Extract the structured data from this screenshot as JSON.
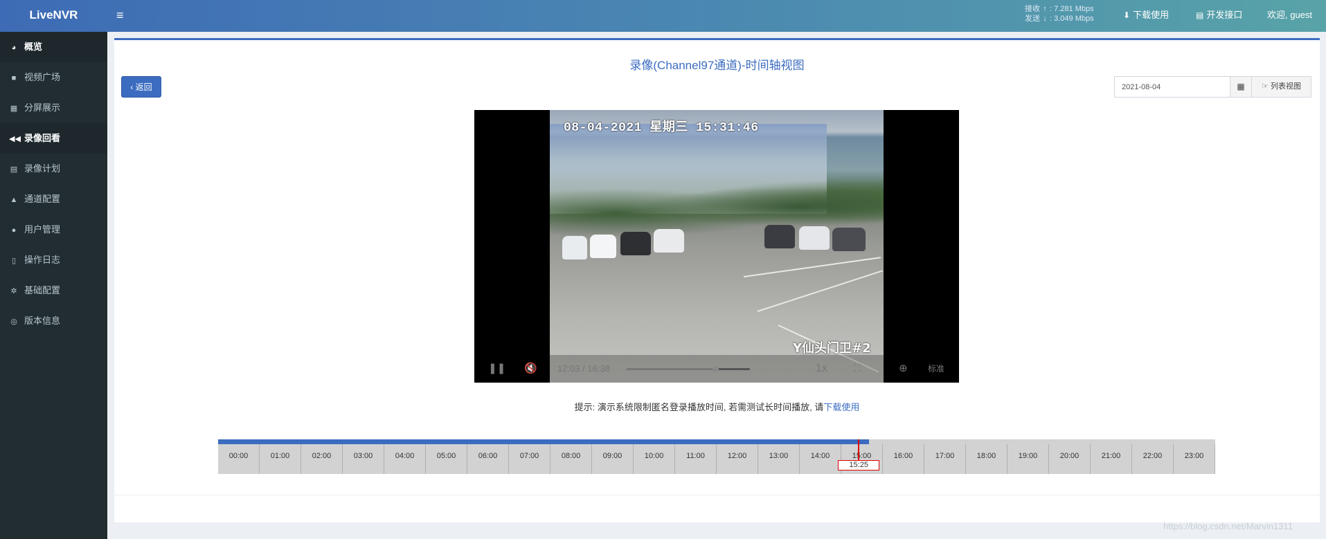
{
  "header": {
    "logo": "LiveNVR",
    "menu_icon": "bars-icon",
    "recv_label": "接收",
    "recv_value": "7.281 Mbps",
    "send_label": "发送",
    "send_value": "3.049 Mbps",
    "download_label": "下载使用",
    "api_label": "开发接口",
    "welcome": "欢迎, guest"
  },
  "sidebar": {
    "items": [
      {
        "label": "概览",
        "icon": "dashboard-icon"
      },
      {
        "label": "视频广场",
        "icon": "video-camera-icon"
      },
      {
        "label": "分屏展示",
        "icon": "grid-icon"
      },
      {
        "label": "录像回看",
        "icon": "backward-icon"
      },
      {
        "label": "录像计划",
        "icon": "calendar-icon"
      },
      {
        "label": "通道配置",
        "icon": "road-icon"
      },
      {
        "label": "用户管理",
        "icon": "users-icon"
      },
      {
        "label": "操作日志",
        "icon": "file-icon"
      },
      {
        "label": "基础配置",
        "icon": "cogs-icon"
      },
      {
        "label": "版本信息",
        "icon": "life-ring-icon"
      }
    ]
  },
  "main": {
    "title": "录像(Channel97通道)-时间轴视图",
    "back_label": "返回",
    "date_value": "2021-08-04",
    "list_view_label": "列表视图",
    "hint_text": "提示: 演示系统限制匿名登录播放时间, 若需测试长时间播放, 请",
    "hint_link": "下载使用"
  },
  "player": {
    "osd_time": "08-04-2021 星期三 15:31:46",
    "osd_name": "Y仙头门卫#2",
    "current_time": "12:03",
    "separator": "/",
    "duration": "16:38",
    "progress": 0.72,
    "speed": "1x",
    "quality": "标准"
  },
  "timeline": {
    "hours": [
      "00:00",
      "01:00",
      "02:00",
      "03:00",
      "04:00",
      "05:00",
      "06:00",
      "07:00",
      "08:00",
      "09:00",
      "10:00",
      "11:00",
      "12:00",
      "13:00",
      "14:00",
      "15:00",
      "16:00",
      "17:00",
      "18:00",
      "19:00",
      "20:00",
      "21:00",
      "22:00",
      "23:00"
    ],
    "recorded_until_hours": 15.67,
    "cursor_hours": 15.42,
    "cursor_label": "15:25"
  },
  "watermark": "https://blog.csdn.net/Marvin1311"
}
